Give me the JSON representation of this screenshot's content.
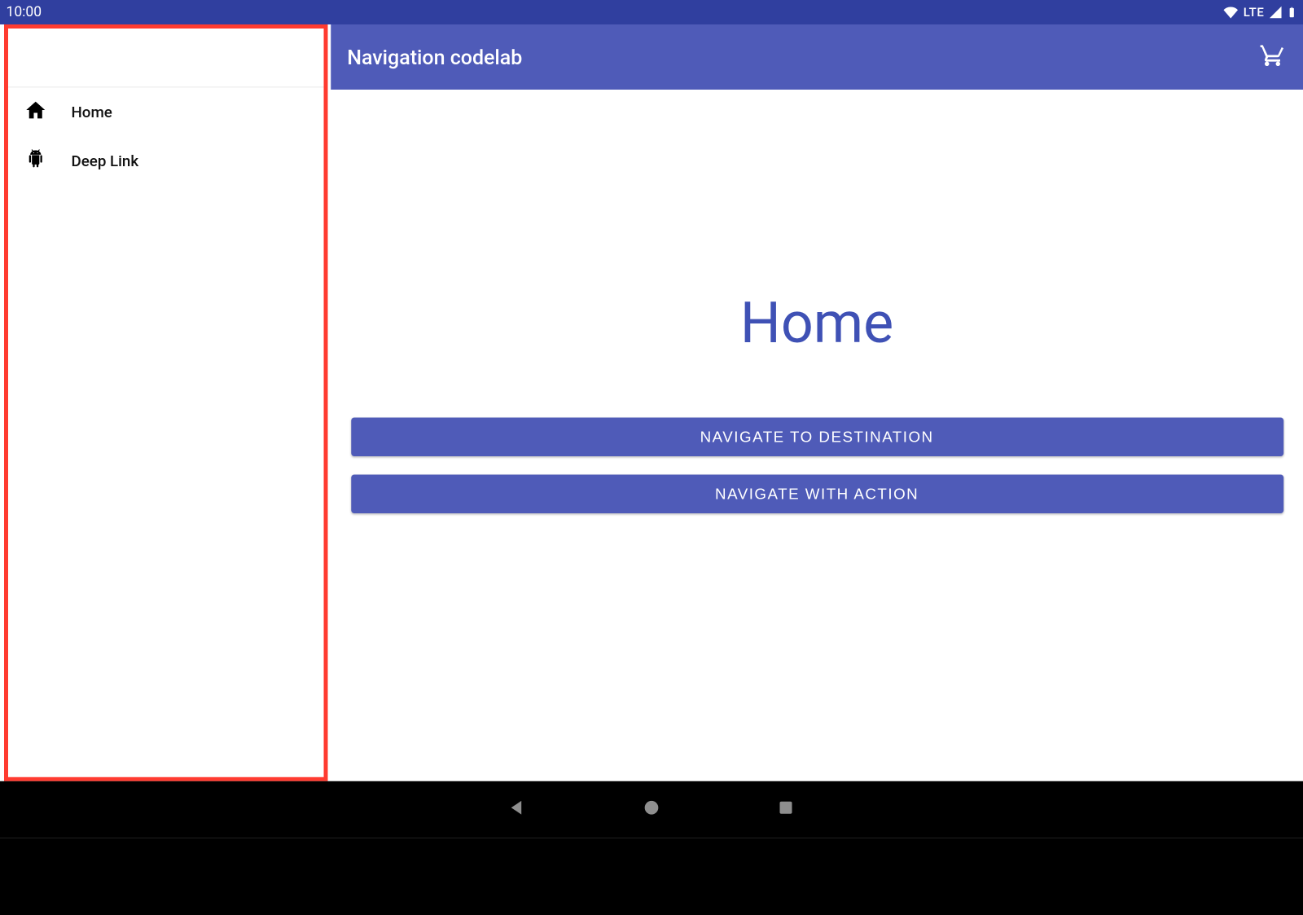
{
  "status": {
    "time": "10:00",
    "network_label": "LTE"
  },
  "appbar": {
    "title": "Navigation codelab",
    "action_icon": "shopping-cart"
  },
  "drawer": {
    "items": [
      {
        "icon": "home",
        "label": "Home"
      },
      {
        "icon": "android",
        "label": "Deep Link"
      }
    ]
  },
  "main": {
    "page_title": "Home",
    "buttons": [
      {
        "label": "NAVIGATE TO DESTINATION"
      },
      {
        "label": "NAVIGATE WITH ACTION"
      }
    ]
  },
  "colors": {
    "primary": "#4F5BB8",
    "primary_dark": "#303F9F",
    "accent_text": "#3F51B5",
    "highlight": "#FF3B30"
  }
}
